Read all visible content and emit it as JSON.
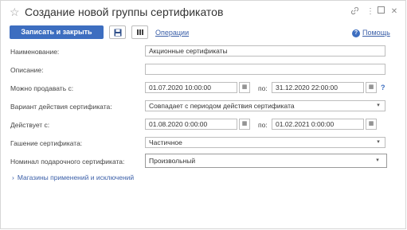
{
  "window": {
    "title": "Создание новой группы сертификатов"
  },
  "toolbar": {
    "save_close_label": "Записать и закрыть",
    "operations_label": "Операции",
    "help_label": "Помощь"
  },
  "form": {
    "name": {
      "label": "Наименование:",
      "value": "Акционные сертификаты"
    },
    "description": {
      "label": "Описание:",
      "value": ""
    },
    "can_sell": {
      "label": "Можно продавать с:",
      "from": "01.07.2020 10:00:00",
      "to_label": "по:",
      "to": "31.12.2020 22:00:00"
    },
    "variant": {
      "label": "Вариант действия сертификата:",
      "value": "Совпадает с периодом действия сертификата"
    },
    "valid": {
      "label": "Действует с:",
      "from": "01.08.2020  0:00:00",
      "to_label": "по:",
      "to": "01.02.2021  0:00:00"
    },
    "redemption": {
      "label": "Гашение сертификата:",
      "value": "Частичное"
    },
    "nominal": {
      "label": "Номинал подарочного сертификата:",
      "value": "Произвольный"
    }
  },
  "groups": {
    "stores_label": "Магазины применений и исключений"
  }
}
